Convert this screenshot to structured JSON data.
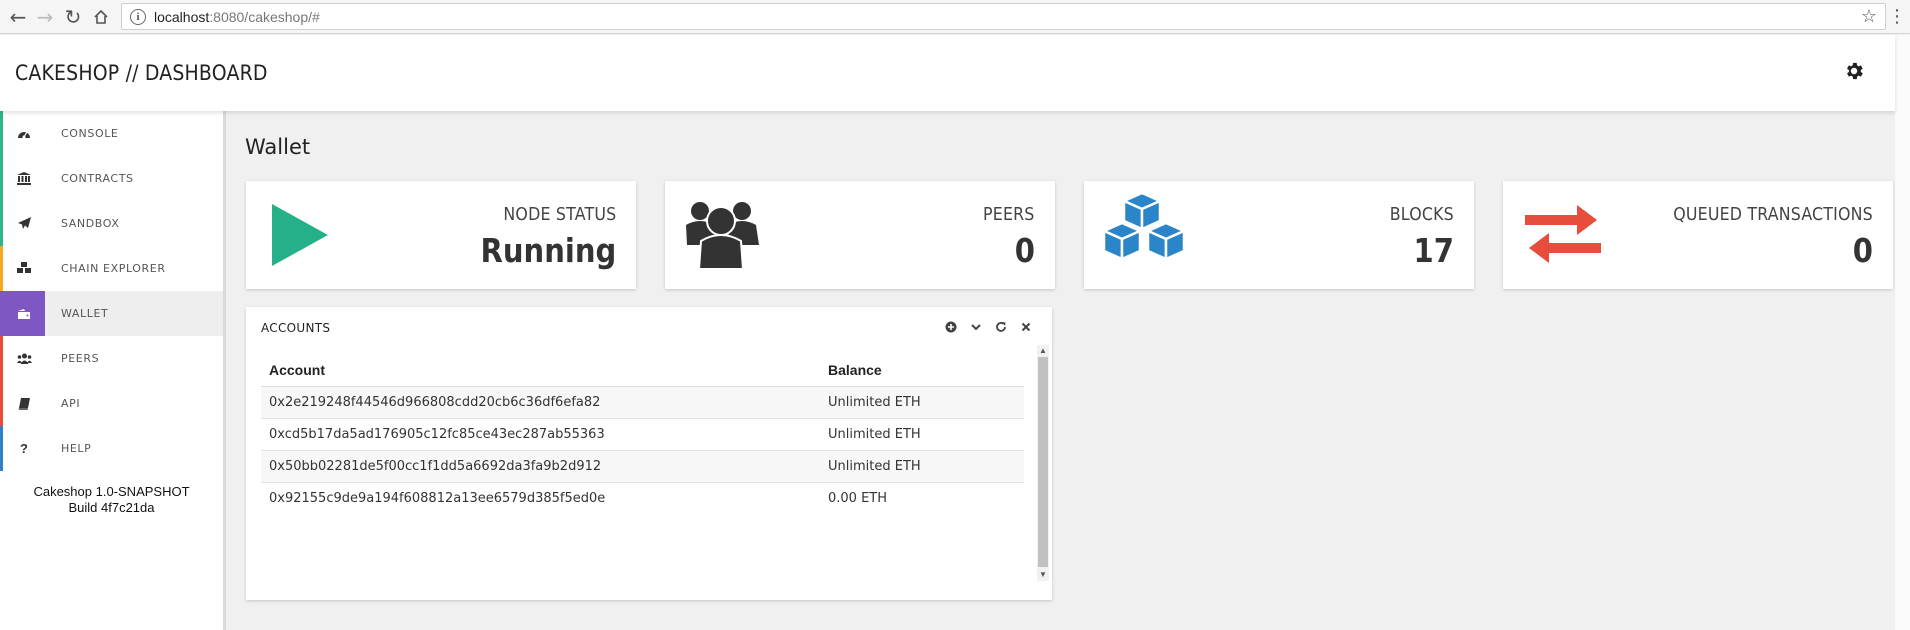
{
  "browser": {
    "url_host": "localhost",
    "url_path": ":8080/cakeshop/#"
  },
  "header": {
    "title": "CAKESHOP // DASHBOARD"
  },
  "sidebar": {
    "items": [
      {
        "label": "CONSOLE",
        "icon": "dashboard-icon",
        "color": "#2fb38a"
      },
      {
        "label": "CONTRACTS",
        "icon": "bank-icon",
        "color": "#2fb38a"
      },
      {
        "label": "SANDBOX",
        "icon": "paper-plane-icon",
        "color": "#2fb38a"
      },
      {
        "label": "CHAIN EXPLORER",
        "icon": "cubes-icon",
        "color": "#f5a623"
      },
      {
        "label": "WALLET",
        "icon": "wallet-icon",
        "color": "#7e57c2"
      },
      {
        "label": "PEERS",
        "icon": "users-icon",
        "color": "#e74c3c"
      },
      {
        "label": "API",
        "icon": "book-icon",
        "color": "#e74c3c"
      },
      {
        "label": "HELP",
        "icon": "question-icon",
        "color": "#2f80c6"
      }
    ],
    "version_line1": "Cakeshop 1.0-SNAPSHOT",
    "version_line2": "Build 4f7c21da"
  },
  "main": {
    "section_title": "Wallet",
    "cards": [
      {
        "label": "NODE STATUS",
        "value": "Running",
        "icon": "play-icon",
        "color": "#26b08a"
      },
      {
        "label": "PEERS",
        "value": "0",
        "icon": "users-icon",
        "color": "#333333"
      },
      {
        "label": "BLOCKS",
        "value": "17",
        "icon": "cubes-icon",
        "color": "#2a86c8"
      },
      {
        "label": "QUEUED TRANSACTIONS",
        "value": "0",
        "icon": "exchange-icon",
        "color": "#e74c3c"
      }
    ],
    "accounts_panel": {
      "title": "ACCOUNTS",
      "columns": [
        "Account",
        "Balance"
      ],
      "rows": [
        {
          "account": "0x2e219248f44546d966808cdd20cb6c36df6efa82",
          "balance": "Unlimited ETH"
        },
        {
          "account": "0xcd5b17da5ad176905c12fc85ce43ec287ab55363",
          "balance": "Unlimited ETH"
        },
        {
          "account": "0x50bb02281de5f00cc1f1dd5a6692da3fa9b2d912",
          "balance": "Unlimited ETH"
        },
        {
          "account": "0x92155c9de9a194f608812a13ee6579d385f5ed0e",
          "balance": "0.00 ETH"
        }
      ]
    }
  }
}
